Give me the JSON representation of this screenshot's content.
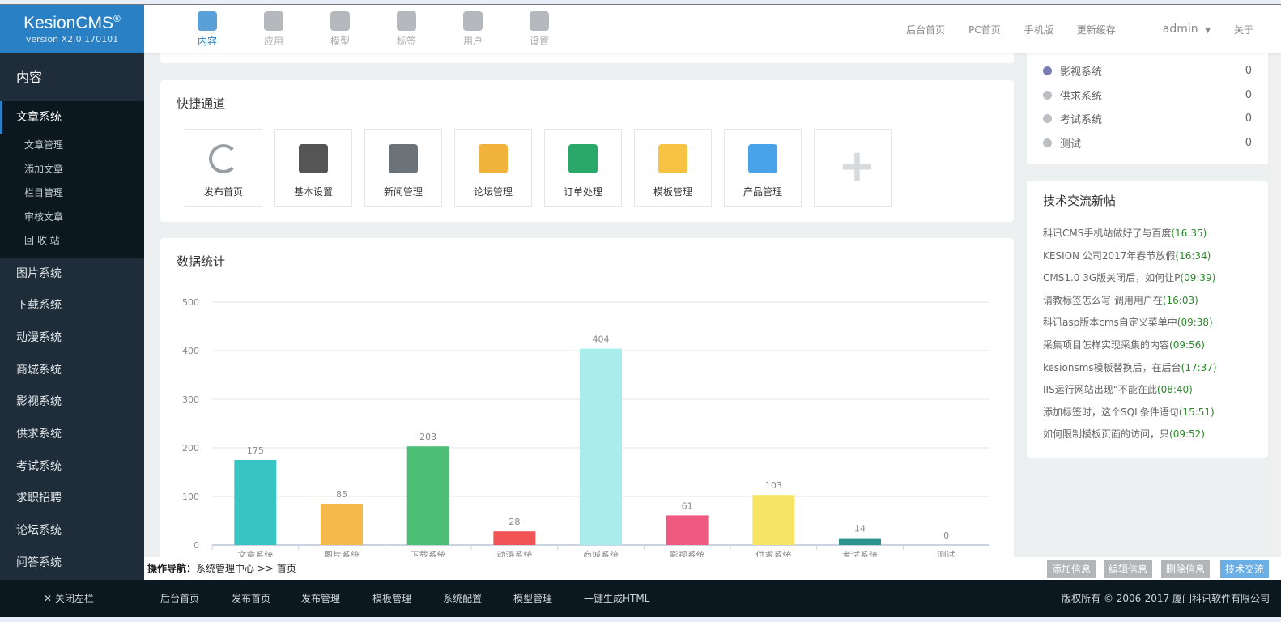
{
  "brand": {
    "name": "KesionCMS",
    "reg": "®",
    "version": "version X2.0.170101"
  },
  "main_nav": [
    {
      "label": "内容",
      "icon": "inbox-icon",
      "active": true
    },
    {
      "label": "应用",
      "icon": "apps-icon"
    },
    {
      "label": "模型",
      "icon": "cube-icon"
    },
    {
      "label": "标签",
      "icon": "bookmark-icon"
    },
    {
      "label": "用户",
      "icon": "user-icon"
    },
    {
      "label": "设置",
      "icon": "gear-icon"
    }
  ],
  "right_nav": {
    "items": [
      "后台首页",
      "PC首页",
      "手机版",
      "更新缓存"
    ],
    "user": "admin",
    "about": "关于"
  },
  "sidebar": {
    "title": "内容",
    "active_group": "文章系统",
    "sub_items": [
      "文章管理",
      "添加文章",
      "栏目管理",
      "审核文章",
      "回 收 站"
    ],
    "systems": [
      "图片系统",
      "下载系统",
      "动漫系统",
      "商城系统",
      "影视系统",
      "供求系统",
      "考试系统",
      "求职招聘",
      "论坛系统",
      "问答系统"
    ]
  },
  "quick": {
    "title": "快捷通道",
    "items": [
      {
        "label": "发布首页",
        "icon": "refresh-icon",
        "color": "#9aa0a6"
      },
      {
        "label": "基本设置",
        "icon": "gears-icon",
        "color": "#555"
      },
      {
        "label": "新闻管理",
        "icon": "newspaper-icon",
        "color": "#6b7278"
      },
      {
        "label": "论坛管理",
        "icon": "chat-users-icon",
        "color": "#f2b33d"
      },
      {
        "label": "订单处理",
        "icon": "clipboard-check-icon",
        "color": "#2aa86a"
      },
      {
        "label": "模板管理",
        "icon": "folder-icon",
        "color": "#f6c342"
      },
      {
        "label": "产品管理",
        "icon": "document-icon",
        "color": "#4aa3e8"
      },
      {
        "label": "",
        "icon": "plus-icon",
        "color": "#d8dbde"
      }
    ]
  },
  "stats": {
    "title": "数据统计"
  },
  "chart_data": {
    "type": "bar",
    "categories": [
      "文章系统",
      "图片系统",
      "下载系统",
      "动漫系统",
      "商城系统",
      "影视系统",
      "供求系统",
      "考试系统",
      "测试"
    ],
    "values": [
      175,
      85,
      203,
      28,
      404,
      61,
      103,
      14,
      0
    ],
    "colors": [
      "#39c4c4",
      "#f5b84a",
      "#4cbf74",
      "#f05454",
      "#a9ecec",
      "#f05a80",
      "#f7e464",
      "#2a938c",
      "#cccccc"
    ],
    "ylim": [
      0,
      500
    ],
    "yticks": [
      0,
      100,
      200,
      300,
      400,
      500
    ],
    "grid": true
  },
  "right_stats": [
    {
      "label": "影视系统",
      "count": "0",
      "color": "#7b7bb5"
    },
    {
      "label": "供求系统",
      "count": "0",
      "color": "#bbbfc4"
    },
    {
      "label": "考试系统",
      "count": "0",
      "color": "#bbbfc4"
    },
    {
      "label": "测试",
      "count": "0",
      "color": "#bbbfc4"
    }
  ],
  "posts": {
    "title": "技术交流新帖",
    "items": [
      {
        "t": "科讯CMS手机站做好了与百度",
        "time": "(16:35)"
      },
      {
        "t": "KESION 公司2017年春节放假",
        "time": "(16:34)"
      },
      {
        "t": "CMS1.0 3G版关闭后，如何让P",
        "time": "(09:39)"
      },
      {
        "t": "请教标签怎么写 调用用户在",
        "time": "(16:03)"
      },
      {
        "t": "科讯asp版本cms自定义菜单中",
        "time": "(09:38)"
      },
      {
        "t": "采集项目怎样实现采集的内容",
        "time": "(09:56)"
      },
      {
        "t": "kesionsms模板替换后，在后台",
        "time": "(17:37)"
      },
      {
        "t": "IIS运行网站出现“不能在此",
        "time": "(08:40)"
      },
      {
        "t": "添加标签时，这个SQL条件语句",
        "time": "(15:51)"
      },
      {
        "t": "如何限制模板页面的访问，只",
        "time": "(09:52)"
      }
    ]
  },
  "breadcrumb": {
    "label": "操作导航：",
    "path": "系统管理中心 >> 首页"
  },
  "actions": [
    "添加信息",
    "编辑信息",
    "删除信息",
    "技术交流"
  ],
  "footer": {
    "close": "关闭左栏",
    "links": [
      "后台首页",
      "发布首页",
      "发布管理",
      "模板管理",
      "系统配置",
      "模型管理",
      "一键生成HTML"
    ],
    "copyright": "版权所有 © 2006-2017 厦门科讯软件有限公司"
  }
}
